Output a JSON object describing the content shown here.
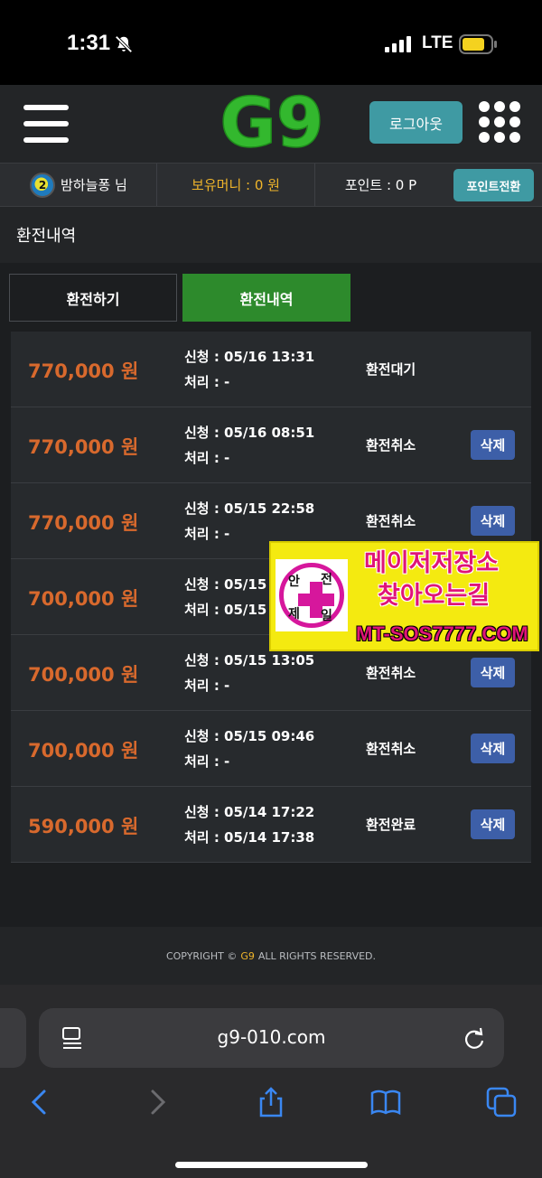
{
  "status_bar": {
    "time": "1:31",
    "network": "LTE"
  },
  "header": {
    "logo": "G9",
    "logout_label": "로그아웃"
  },
  "user_bar": {
    "avatar_label": "2",
    "username": "밤하늘퐁 님",
    "money_label": "보유머니 : 0 원",
    "point_label": "포인트 : 0 P",
    "point_button": "포인트전환"
  },
  "page": {
    "title": "환전내역"
  },
  "tabs": [
    {
      "label": "환전하기",
      "active": false
    },
    {
      "label": "환전내역",
      "active": true
    }
  ],
  "rows": [
    {
      "amount": "770,000 원",
      "request": "신청 : 05/16 13:31",
      "process": "처리 : -",
      "status": "환전대기",
      "delete": ""
    },
    {
      "amount": "770,000 원",
      "request": "신청 : 05/16 08:51",
      "process": "처리 : -",
      "status": "환전취소",
      "delete": "삭제"
    },
    {
      "amount": "770,000 원",
      "request": "신청 : 05/15 22:58",
      "process": "처리 : -",
      "status": "환전취소",
      "delete": "삭제"
    },
    {
      "amount": "700,000 원",
      "request": "신청 : 05/15 1",
      "process": "처리 : 05/15 1",
      "status": "",
      "delete": ""
    },
    {
      "amount": "700,000 원",
      "request": "신청 : 05/15 13:05",
      "process": "처리 : -",
      "status": "환전취소",
      "delete": "삭제"
    },
    {
      "amount": "700,000 원",
      "request": "신청 : 05/15 09:46",
      "process": "처리 : -",
      "status": "환전취소",
      "delete": "삭제"
    },
    {
      "amount": "590,000 원",
      "request": "신청 : 05/14 17:22",
      "process": "처리 : 05/14 17:38",
      "status": "환전완료",
      "delete": "삭제"
    }
  ],
  "footer": {
    "prefix": "COPYRIGHT ©",
    "brand": "G9",
    "suffix": "ALL RIGHTS RESERVED."
  },
  "ad": {
    "badge_chars": [
      "안",
      "전",
      "제",
      "일"
    ],
    "line1": "메이저저장소",
    "line2": "찾아오는길",
    "url": "MT-SOS7777.COM"
  },
  "browser": {
    "url": "g9-010.com"
  },
  "colors": {
    "accent_teal": "#3f9aa3",
    "active_tab_green": "#2d8a2c",
    "amount_orange": "#d8692d",
    "money_gold": "#f0b52a",
    "delete_blue": "#3d5fa8"
  }
}
